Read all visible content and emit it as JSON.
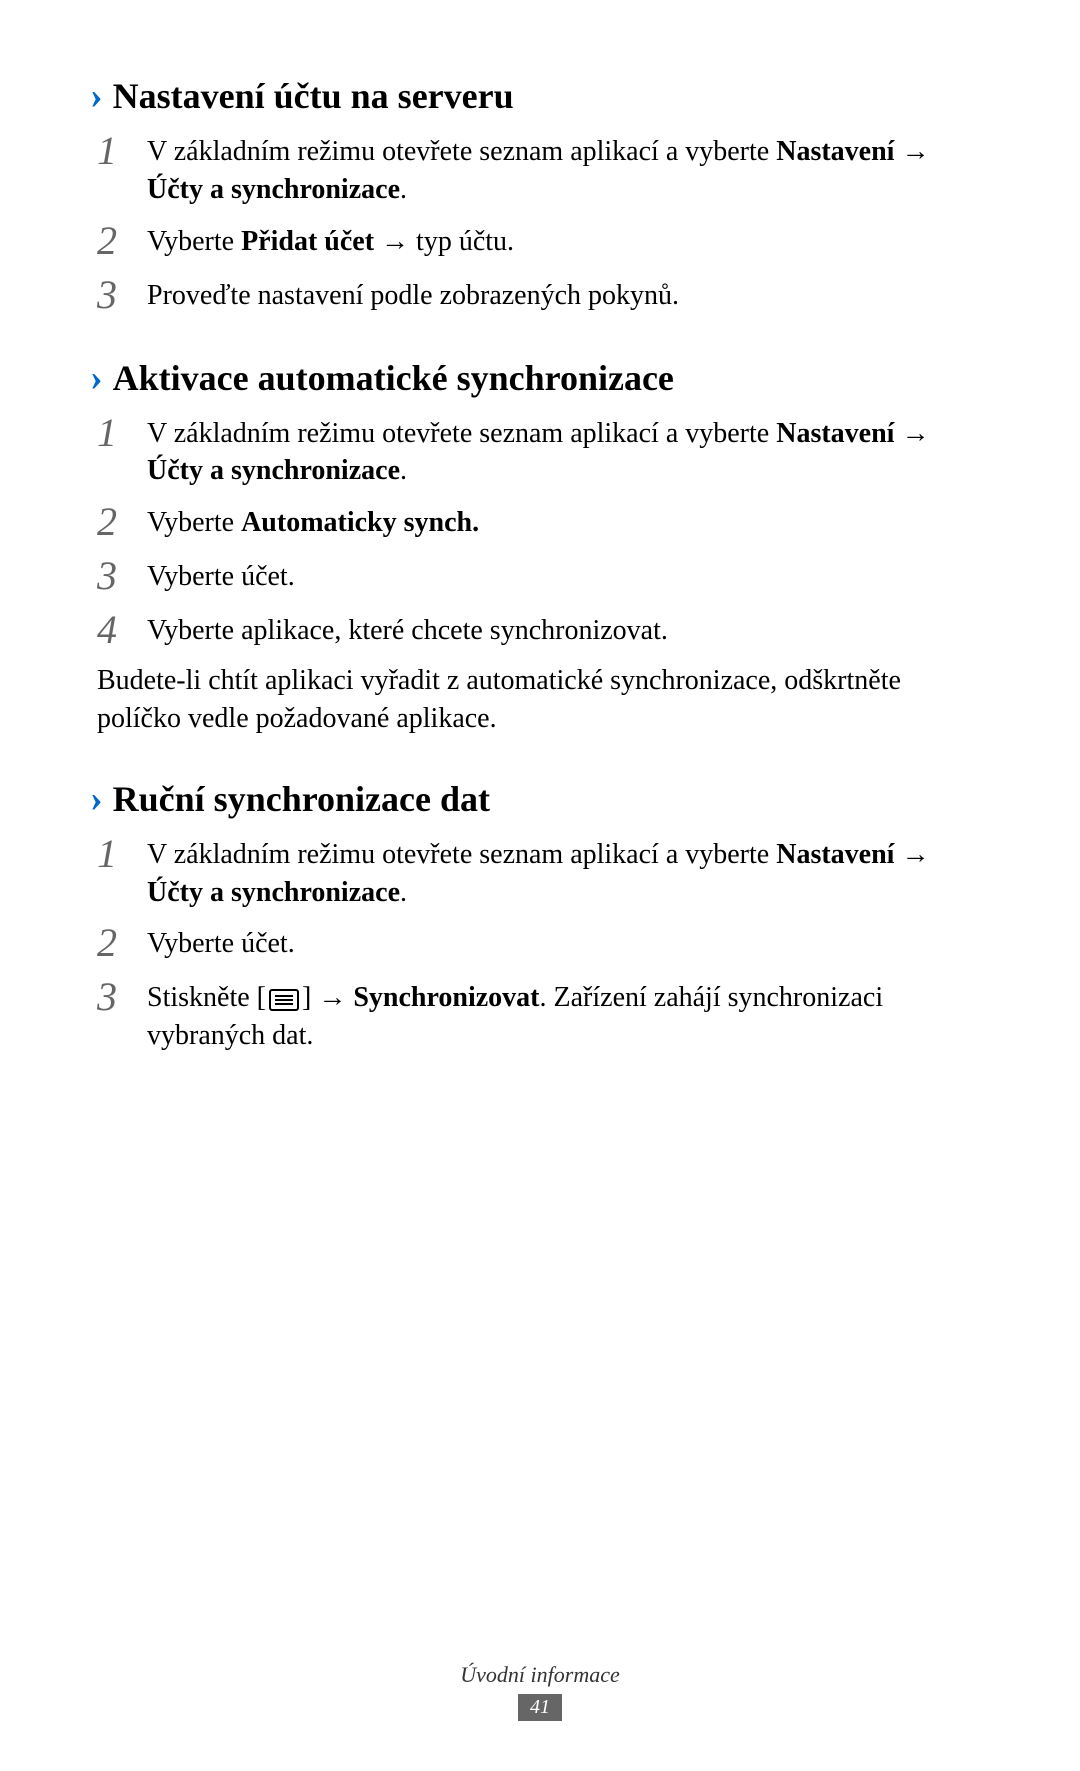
{
  "sections": [
    {
      "heading": "Nastavení účtu na serveru",
      "steps": [
        {
          "num": "1",
          "parts": [
            {
              "text": "V základním režimu otevřete seznam aplikací a vyberte ",
              "bold": false
            },
            {
              "text": "Nastavení",
              "bold": true
            },
            {
              "text": " → ",
              "bold": true,
              "arrow": true
            },
            {
              "text": "Účty a synchronizace",
              "bold": true
            },
            {
              "text": ".",
              "bold": false
            }
          ]
        },
        {
          "num": "2",
          "parts": [
            {
              "text": "Vyberte ",
              "bold": false
            },
            {
              "text": "Přidat účet",
              "bold": true
            },
            {
              "text": " → typ účtu.",
              "bold": false
            }
          ]
        },
        {
          "num": "3",
          "parts": [
            {
              "text": "Proveďte nastavení podle zobrazených pokynů.",
              "bold": false
            }
          ]
        }
      ]
    },
    {
      "heading": "Aktivace automatické synchronizace",
      "steps": [
        {
          "num": "1",
          "parts": [
            {
              "text": "V základním režimu otevřete seznam aplikací a vyberte ",
              "bold": false
            },
            {
              "text": "Nastavení",
              "bold": true
            },
            {
              "text": " → ",
              "bold": true,
              "arrow": true
            },
            {
              "text": "Účty a synchronizace",
              "bold": true
            },
            {
              "text": ".",
              "bold": false
            }
          ]
        },
        {
          "num": "2",
          "parts": [
            {
              "text": "Vyberte ",
              "bold": false
            },
            {
              "text": "Automaticky synch.",
              "bold": true
            }
          ]
        },
        {
          "num": "3",
          "parts": [
            {
              "text": "Vyberte účet.",
              "bold": false
            }
          ]
        },
        {
          "num": "4",
          "parts": [
            {
              "text": "Vyberte aplikace, které chcete synchronizovat.",
              "bold": false
            }
          ]
        }
      ],
      "after": "Budete-li chtít aplikaci vyřadit z automatické synchronizace, odškrtněte políčko vedle požadované aplikace."
    },
    {
      "heading": "Ruční synchronizace dat",
      "steps": [
        {
          "num": "1",
          "parts": [
            {
              "text": "V základním režimu otevřete seznam aplikací a vyberte ",
              "bold": false
            },
            {
              "text": "Nastavení",
              "bold": true
            },
            {
              "text": " → ",
              "bold": true,
              "arrow": true
            },
            {
              "text": "Účty a synchronizace",
              "bold": true
            },
            {
              "text": ".",
              "bold": false
            }
          ]
        },
        {
          "num": "2",
          "parts": [
            {
              "text": "Vyberte účet.",
              "bold": false
            }
          ]
        },
        {
          "num": "3",
          "parts": [
            {
              "text": "Stiskněte [",
              "bold": false
            },
            {
              "icon": "menu"
            },
            {
              "text": "] → ",
              "bold": false
            },
            {
              "text": "Synchronizovat",
              "bold": true
            },
            {
              "text": ". Zařízení zahájí synchronizaci vybraných dat.",
              "bold": false
            }
          ]
        }
      ]
    }
  ],
  "footer": {
    "section_name": "Úvodní informace",
    "page_number": "41"
  }
}
